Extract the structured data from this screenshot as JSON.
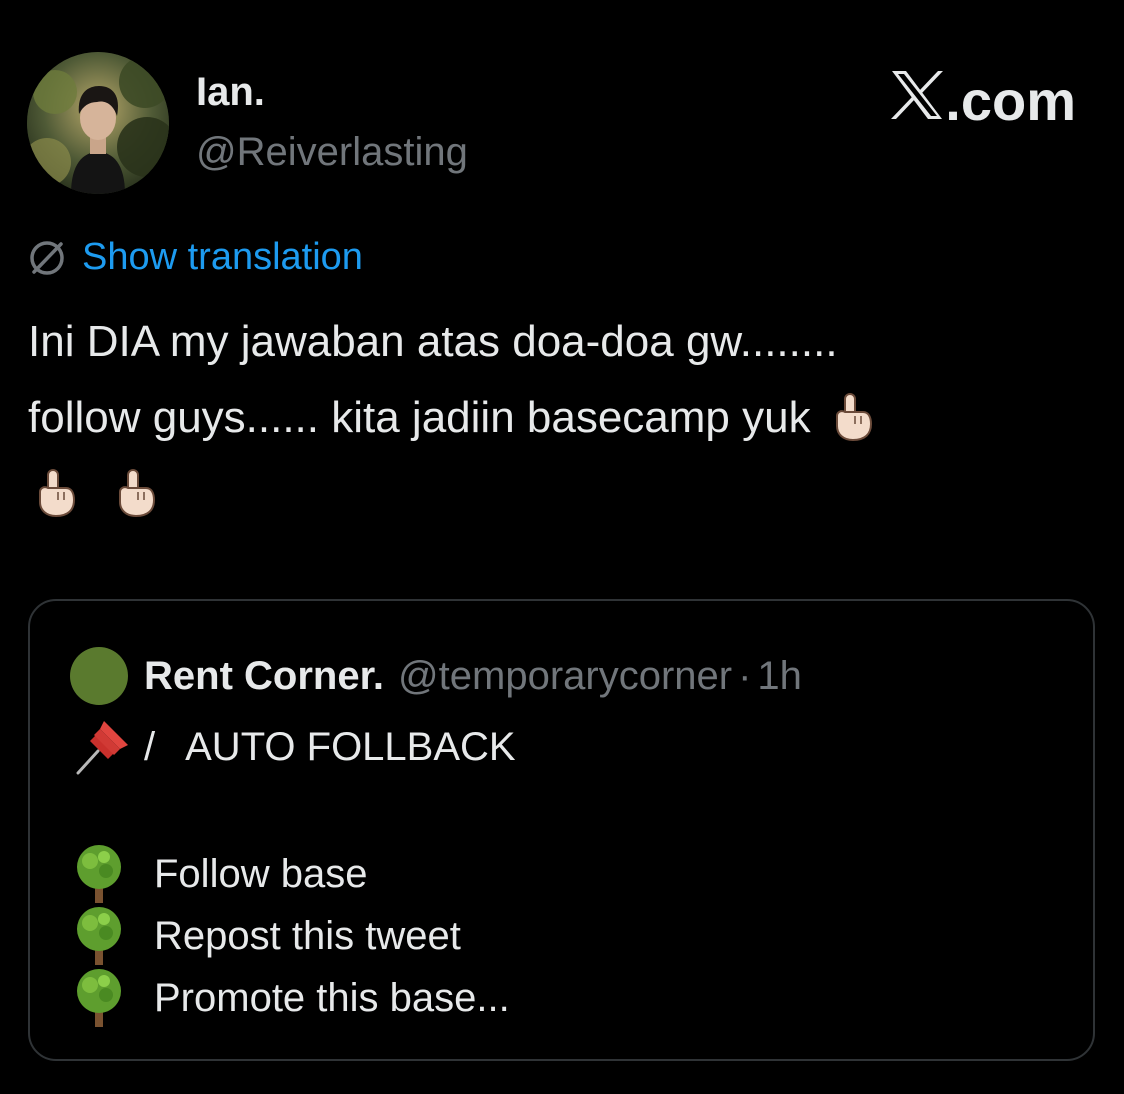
{
  "author": {
    "display_name": "Ian.",
    "handle": "@Reiverlasting"
  },
  "brand": {
    "logo_icon": "x-logo-icon",
    "domain_suffix": ".com"
  },
  "translation": {
    "icon": "globe-icon",
    "label": "Show translation"
  },
  "tweet": {
    "line1": "Ini DIA my jawaban atas doa-doa gw........",
    "line2": "follow guys...... kita jadiin basecamp yuk",
    "emoji": "index-pointing-up-icon",
    "emoji_count": 3
  },
  "quote": {
    "avatar_color": "#5a7a2e",
    "name": "Rent Corner.",
    "handle": "@temporarycorner",
    "separator": "·",
    "time": "1h",
    "title_icon": "pushpin-icon",
    "title_sep": "/",
    "title": "AUTO FOLLBACK",
    "bullet_icon": "tree-icon",
    "items": [
      "Follow base",
      "Repost this tweet",
      "Promote this base..."
    ]
  },
  "colors": {
    "background": "#000000",
    "text": "#e7e9ea",
    "secondary": "#71767b",
    "link": "#1d9bf0",
    "border": "#2f3336"
  }
}
